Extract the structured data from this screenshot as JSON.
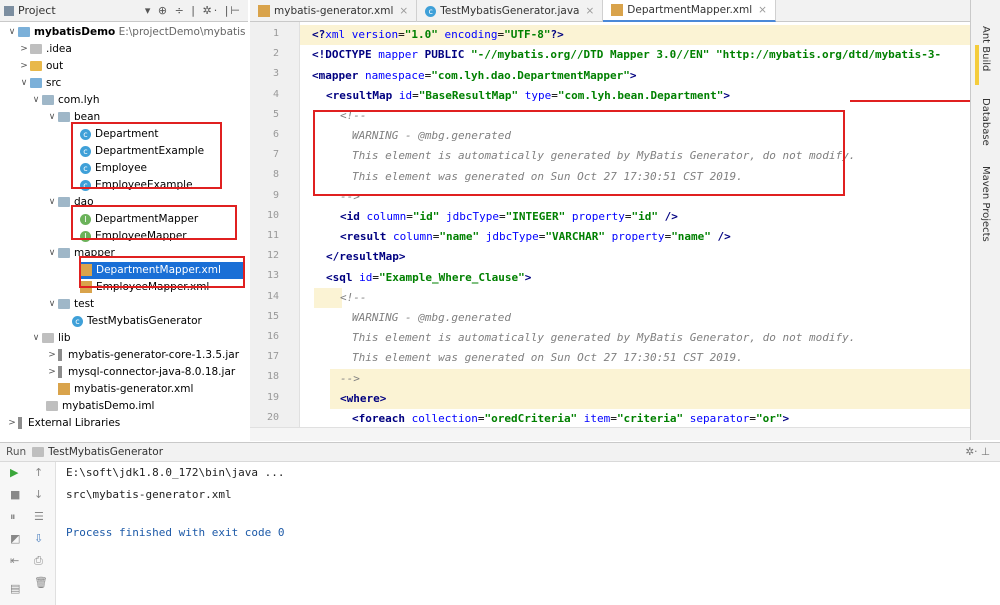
{
  "project_panel": {
    "title": "Project",
    "tools": "▾ ⊕ ÷ | ✲· |⊢"
  },
  "tree": [
    {
      "label": "mybatisDemo",
      "extra": "E:\\projectDemo\\mybatisDem",
      "bold": true
    },
    {
      "label": ".idea"
    },
    {
      "label": "out"
    },
    {
      "label": "src"
    },
    {
      "label": "com.lyh"
    },
    {
      "label": "bean"
    },
    {
      "label": "Department"
    },
    {
      "label": "DepartmentExample"
    },
    {
      "label": "Employee"
    },
    {
      "label": "EmployeeExample"
    },
    {
      "label": "dao"
    },
    {
      "label": "DepartmentMapper"
    },
    {
      "label": "EmployeeMapper"
    },
    {
      "label": "mapper"
    },
    {
      "label": "DepartmentMapper.xml"
    },
    {
      "label": "EmployeeMapper.xml"
    },
    {
      "label": "test"
    },
    {
      "label": "TestMybatisGenerator"
    },
    {
      "label": "lib"
    },
    {
      "label": "mybatis-generator-core-1.3.5.jar"
    },
    {
      "label": "mysql-connector-java-8.0.18.jar"
    },
    {
      "label": "mybatis-generator.xml"
    },
    {
      "label": "mybatisDemo.iml"
    },
    {
      "label": "External Libraries"
    }
  ],
  "tabs": [
    {
      "label": "mybatis-generator.xml",
      "close": "×"
    },
    {
      "label": "TestMybatisGenerator.java",
      "close": "×"
    },
    {
      "label": "DepartmentMapper.xml",
      "close": "×"
    }
  ],
  "line_numbers": [
    "1",
    "2",
    "3",
    "4",
    "5",
    "6",
    "7",
    "8",
    "9",
    "10",
    "11",
    "12",
    "13",
    "14",
    "15",
    "16",
    "17",
    "18",
    "19",
    "20"
  ],
  "code": {
    "l1": {
      "a": "<?",
      "b": "xml version",
      "c": "=",
      "d": "\"1.0\"",
      "e": " encoding",
      "f": "=",
      "g": "\"UTF-8\"",
      "h": "?>"
    },
    "l2": {
      "a": "<!DOCTYPE ",
      "b": "mapper ",
      "c": "PUBLIC ",
      "d": "\"-//mybatis.org//DTD Mapper 3.0//EN\" ",
      "e": "\"http://mybatis.org/dtd/mybatis-3-"
    },
    "l3": {
      "a": "<mapper ",
      "b": "namespace",
      "c": "=",
      "d": "\"com.lyh.dao.DepartmentMapper\"",
      "e": ">"
    },
    "l4": {
      "a": "<resultMap ",
      "b": "id",
      "c": "=",
      "d": "\"BaseResultMap\"",
      "e": " type",
      "f": "=",
      "g": "\"com.lyh.bean.Department\"",
      "h": ">"
    },
    "l5": "<!--",
    "l6": "WARNING - @mbg.generated",
    "l7": "This element is automatically generated by MyBatis Generator, do not modify.",
    "l8": "This element was generated on Sun Oct 27 17:30:51 CST 2019.",
    "l9": "-->",
    "l10": {
      "a": "<id ",
      "b": "column",
      "c": "=",
      "d": "\"id\"",
      "e": " jdbcType",
      "f": "=",
      "g": "\"INTEGER\"",
      "h": " property",
      "i": "=",
      "j": "\"id\"",
      "k": " />"
    },
    "l11": {
      "a": "<result ",
      "b": "column",
      "c": "=",
      "d": "\"name\"",
      "e": " jdbcType",
      "f": "=",
      "g": "\"VARCHAR\"",
      "h": " property",
      "i": "=",
      "j": "\"name\"",
      "k": " />"
    },
    "l12": "</resultMap>",
    "l13": {
      "a": "<sql ",
      "b": "id",
      "c": "=",
      "d": "\"Example_Where_Clause\"",
      "e": ">"
    },
    "l14": "<!--",
    "l15": "WARNING - @mbg.generated",
    "l16": "This element is automatically generated by MyBatis Generator, do not modify.",
    "l17": "This element was generated on Sun Oct 27 17:30:51 CST 2019.",
    "l18": "-->",
    "l19": "<where>",
    "l20": {
      "a": "<foreach ",
      "b": "collection",
      "c": "=",
      "d": "\"oredCriteria\"",
      "e": " item",
      "f": "=",
      "g": "\"criteria\"",
      "h": " separator",
      "i": "=",
      "j": "\"or\"",
      "k": ">"
    }
  },
  "right_sidebar": {
    "ant": "Ant Build",
    "db": "Database",
    "maven": "Maven Projects"
  },
  "run": {
    "label": "Run",
    "config": "TestMybatisGenerator",
    "tools": "✲· ⊥"
  },
  "console": [
    "E:\\soft\\jdk1.8.0_172\\bin\\java ...",
    "src\\mybatis-generator.xml",
    "",
    "Process finished with exit code 0"
  ]
}
